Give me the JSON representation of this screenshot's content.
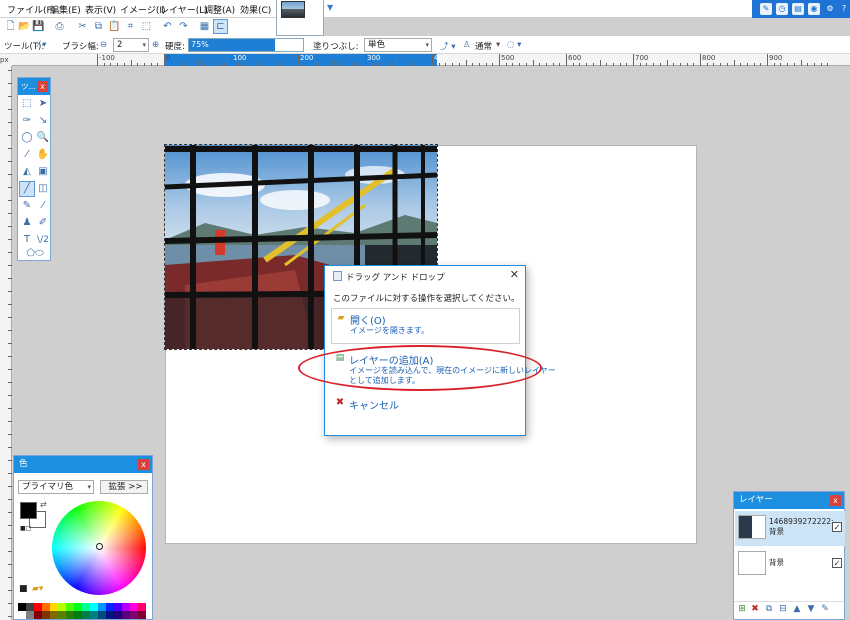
{
  "menu": {
    "items": [
      "ファイル(F)",
      "編集(E)",
      "表示(V)",
      "イメージ(I)",
      "レイヤー(L)",
      "調整(A)",
      "効果(C)"
    ]
  },
  "toolbar2": {
    "tool_label": "ツール(T):",
    "brush_width_label": "ブラシ幅:",
    "brush_width_value": "2",
    "hardness_label": "硬度:",
    "hardness_value": "75%",
    "hardness_level": 0.75,
    "fill_label": "塗りつぶし:",
    "fill_value": "単色",
    "blend_value": "通常"
  },
  "ruler": {
    "corner": "px",
    "labels": [
      "-100",
      "0",
      "100",
      "200",
      "300",
      "400",
      "500",
      "600",
      "700",
      "800",
      "900"
    ]
  },
  "tools_panel": {
    "title": "ツ...",
    "close": "x"
  },
  "dialog": {
    "title": "ドラッグ アンド ドロップ",
    "close": "✕",
    "prompt": "このファイルに対する操作を選択してください。",
    "options": [
      {
        "title": "開く(O)",
        "desc": [
          "イメージを開きます。"
        ]
      },
      {
        "title": "レイヤーの追加(A)",
        "desc": [
          "イメージを読み込んで、現在のイメージに新しいレイヤー",
          "として追加します。"
        ]
      },
      {
        "title": "キャンセル",
        "desc": []
      }
    ]
  },
  "color_panel": {
    "title": "色",
    "close": "x",
    "mode": "プライマリ色",
    "expand_button": "拡張 >>"
  },
  "layers_panel": {
    "title": "レイヤー",
    "close": "x",
    "layers": [
      {
        "name_line1": "1468939272222:",
        "name_line2": "背景",
        "checked": "✓"
      },
      {
        "name_line1": "背景",
        "name_line2": "",
        "checked": "✓"
      }
    ]
  },
  "colors": {
    "accent": "#1e8fe0",
    "highlight": "#d8222a",
    "selection": "#1e7fd4",
    "canvas_bg": "#cfcfcf"
  }
}
